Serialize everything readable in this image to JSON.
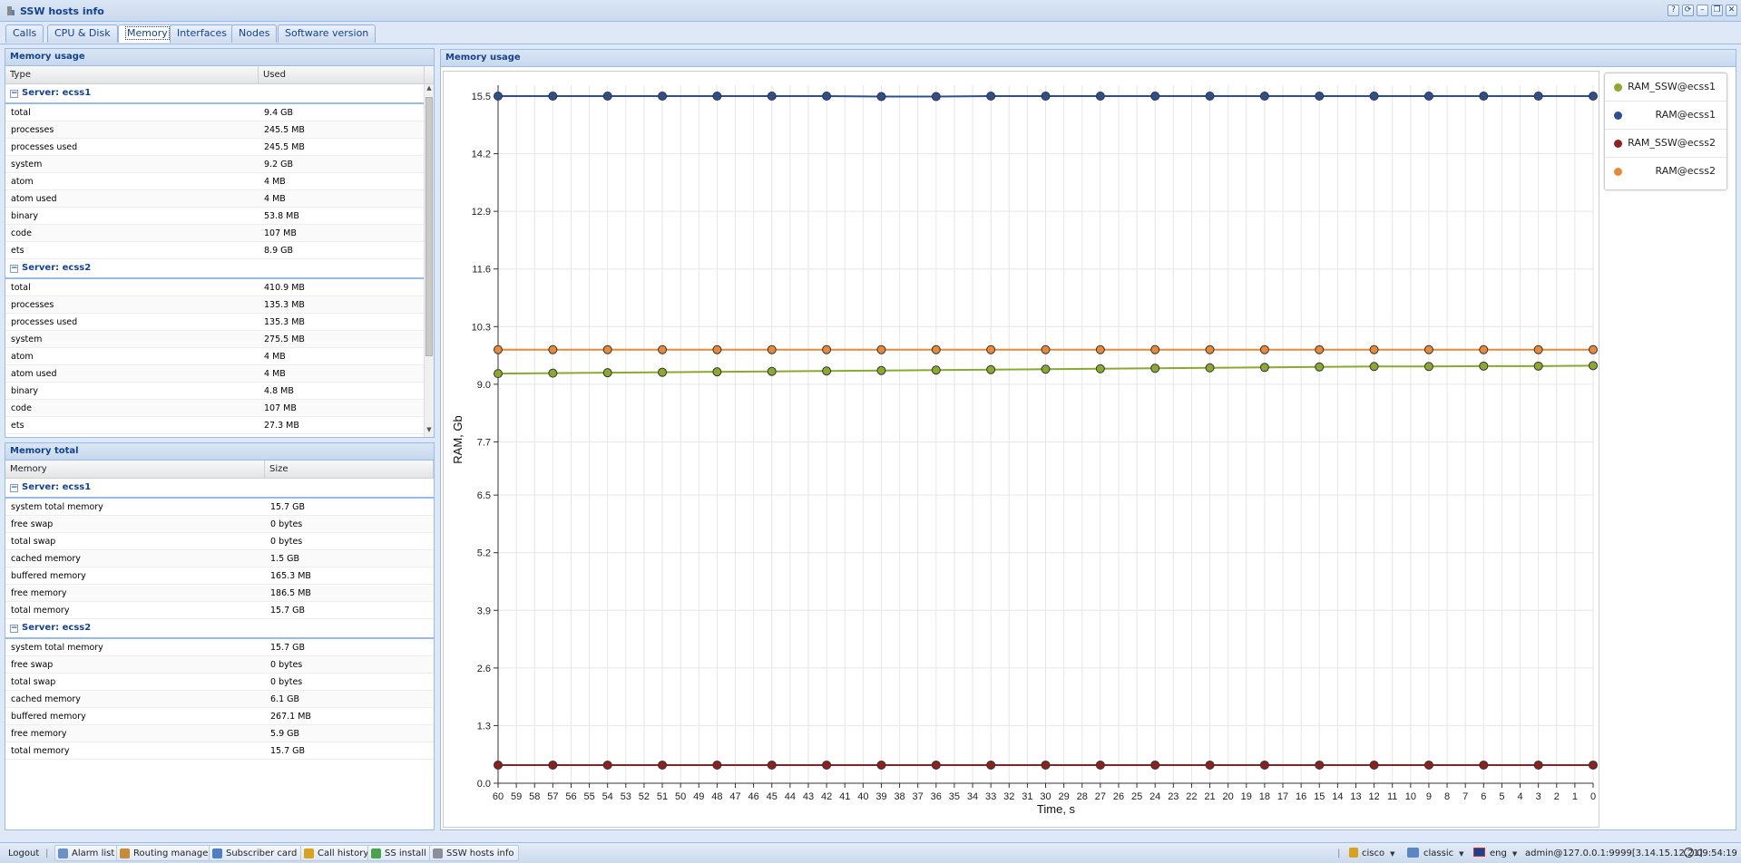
{
  "window": {
    "title": "SSW hosts info",
    "buttons": [
      "?",
      "⟳",
      "–",
      "❐",
      "✕"
    ]
  },
  "tabs": [
    {
      "label": "Calls",
      "active": false
    },
    {
      "label": "CPU & Disk",
      "active": false
    },
    {
      "label": "Memory",
      "active": true
    },
    {
      "label": "Interfaces",
      "active": false
    },
    {
      "label": "Nodes",
      "active": false
    },
    {
      "label": "Software version",
      "active": false
    }
  ],
  "memory_usage": {
    "title": "Memory usage",
    "columns": [
      "Type",
      "Used"
    ],
    "groups": [
      {
        "label": "Server: ecss1",
        "rows": [
          [
            "total",
            "9.4 GB"
          ],
          [
            "processes",
            "245.5 MB"
          ],
          [
            "processes used",
            "245.5 MB"
          ],
          [
            "system",
            "9.2 GB"
          ],
          [
            "atom",
            "4 MB"
          ],
          [
            "atom used",
            "4 MB"
          ],
          [
            "binary",
            "53.8 MB"
          ],
          [
            "code",
            "107 MB"
          ],
          [
            "ets",
            "8.9 GB"
          ]
        ]
      },
      {
        "label": "Server: ecss2",
        "rows": [
          [
            "total",
            "410.9 MB"
          ],
          [
            "processes",
            "135.3 MB"
          ],
          [
            "processes used",
            "135.3 MB"
          ],
          [
            "system",
            "275.5 MB"
          ],
          [
            "atom",
            "4 MB"
          ],
          [
            "atom used",
            "4 MB"
          ],
          [
            "binary",
            "4.8 MB"
          ],
          [
            "code",
            "107 MB"
          ],
          [
            "ets",
            "27.3 MB"
          ]
        ]
      }
    ]
  },
  "memory_total": {
    "title": "Memory total",
    "columns": [
      "Memory",
      "Size"
    ],
    "groups": [
      {
        "label": "Server: ecss1",
        "rows": [
          [
            "system total memory",
            "15.7 GB"
          ],
          [
            "free swap",
            "0 bytes"
          ],
          [
            "total swap",
            "0 bytes"
          ],
          [
            "cached memory",
            "1.5 GB"
          ],
          [
            "buffered memory",
            "165.3 MB"
          ],
          [
            "free memory",
            "186.5 MB"
          ],
          [
            "total memory",
            "15.7 GB"
          ]
        ]
      },
      {
        "label": "Server: ecss2",
        "rows": [
          [
            "system total memory",
            "15.7 GB"
          ],
          [
            "free swap",
            "0 bytes"
          ],
          [
            "total swap",
            "0 bytes"
          ],
          [
            "cached memory",
            "6.1 GB"
          ],
          [
            "buffered memory",
            "267.1 MB"
          ],
          [
            "free memory",
            "5.9 GB"
          ],
          [
            "total memory",
            "15.7 GB"
          ]
        ]
      }
    ]
  },
  "chart_panel": {
    "title": "Memory usage"
  },
  "chart_data": {
    "type": "line",
    "title": "",
    "xlabel": "Time, s",
    "ylabel": "RAM, Gb",
    "ylim": [
      0,
      15.5
    ],
    "yticks": [
      0.0,
      1.3,
      2.6,
      3.9,
      5.2,
      6.5,
      7.7,
      9.0,
      10.3,
      11.6,
      12.9,
      14.2,
      15.5
    ],
    "xlim": [
      60,
      0
    ],
    "xticks": [
      60,
      59,
      58,
      57,
      56,
      55,
      54,
      53,
      52,
      51,
      50,
      49,
      48,
      47,
      46,
      45,
      44,
      43,
      42,
      41,
      40,
      39,
      38,
      37,
      36,
      35,
      34,
      33,
      32,
      31,
      30,
      29,
      28,
      27,
      26,
      25,
      24,
      23,
      22,
      21,
      20,
      19,
      18,
      17,
      16,
      15,
      14,
      13,
      12,
      11,
      10,
      9,
      8,
      7,
      6,
      5,
      4,
      3,
      2,
      1,
      0
    ],
    "x": [
      60,
      57,
      54,
      51,
      48,
      45,
      42,
      39,
      36,
      33,
      30,
      27,
      24,
      21,
      18,
      15,
      12,
      9,
      6,
      3,
      0
    ],
    "grid": true,
    "legend_position": "right",
    "series": [
      {
        "name": "RAM_SSW@ecss1",
        "color": "#8aa832",
        "values": [
          9.24,
          9.25,
          9.26,
          9.27,
          9.28,
          9.29,
          9.3,
          9.31,
          9.32,
          9.33,
          9.34,
          9.35,
          9.36,
          9.37,
          9.38,
          9.39,
          9.4,
          9.4,
          9.41,
          9.41,
          9.42
        ]
      },
      {
        "name": "RAM@ecss1",
        "color": "#2e4f8f",
        "values": [
          15.5,
          15.5,
          15.5,
          15.5,
          15.5,
          15.5,
          15.5,
          15.49,
          15.49,
          15.5,
          15.5,
          15.5,
          15.5,
          15.5,
          15.5,
          15.5,
          15.5,
          15.5,
          15.5,
          15.5,
          15.5
        ]
      },
      {
        "name": "RAM_SSW@ecss2",
        "color": "#8b2222",
        "values": [
          0.41,
          0.41,
          0.41,
          0.41,
          0.41,
          0.41,
          0.41,
          0.41,
          0.41,
          0.41,
          0.41,
          0.41,
          0.41,
          0.41,
          0.41,
          0.41,
          0.41,
          0.41,
          0.41,
          0.41,
          0.41
        ]
      },
      {
        "name": "RAM@ecss2",
        "color": "#e8893a",
        "values": [
          9.78,
          9.78,
          9.78,
          9.78,
          9.78,
          9.78,
          9.78,
          9.78,
          9.78,
          9.78,
          9.78,
          9.78,
          9.78,
          9.78,
          9.78,
          9.78,
          9.78,
          9.78,
          9.78,
          9.78,
          9.78
        ]
      }
    ]
  },
  "taskbar": {
    "logout": "Logout",
    "items": [
      {
        "label": "Alarm list",
        "icon": "alarm-icon",
        "color": "#6b8fc7"
      },
      {
        "label": "Routing manager",
        "icon": "routing-icon",
        "color": "#c98a3a"
      },
      {
        "label": "Subscriber card",
        "icon": "subscriber-card-icon",
        "color": "#4f7fc0"
      },
      {
        "label": "Call history",
        "icon": "call-history-icon",
        "color": "#d8a21c"
      },
      {
        "label": "SS install",
        "icon": "ss-install-icon",
        "color": "#4aa34a"
      },
      {
        "label": "SSW hosts info",
        "icon": "hosts-info-icon",
        "color": "#8a8f99"
      }
    ],
    "user": "cisco",
    "theme": "classic",
    "lang": "eng",
    "session": "admin@127.0.0.1:9999[3.14.15.12.21]",
    "clock": "09:54:19"
  }
}
